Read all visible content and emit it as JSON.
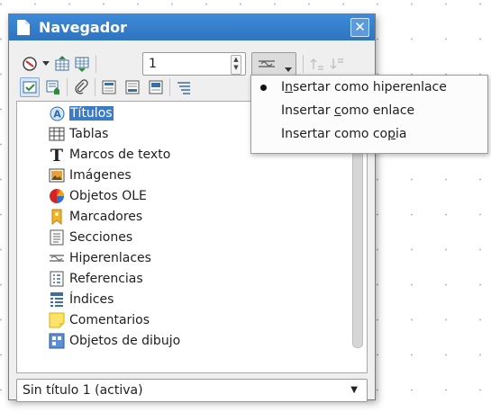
{
  "window": {
    "title": "Navegador",
    "close_glyph": "✕"
  },
  "toolbar": {
    "page_value": "1",
    "drag_mode_icon": "hyperlink-drag-icon",
    "colors": {
      "accent": "#2f74bf",
      "selection": "#3a7cc8"
    }
  },
  "tree": {
    "items": [
      {
        "label": "Títulos",
        "icon": "headings-icon"
      },
      {
        "label": "Tablas",
        "icon": "table-icon"
      },
      {
        "label": "Marcos de texto",
        "icon": "text-frame-icon"
      },
      {
        "label": "Imágenes",
        "icon": "image-icon"
      },
      {
        "label": "Objetos OLE",
        "icon": "ole-object-icon"
      },
      {
        "label": "Marcadores",
        "icon": "bookmark-icon"
      },
      {
        "label": "Secciones",
        "icon": "section-icon"
      },
      {
        "label": "Hiperenlaces",
        "icon": "hyperlink-icon"
      },
      {
        "label": "Referencias",
        "icon": "reference-icon"
      },
      {
        "label": "Índices",
        "icon": "index-icon"
      },
      {
        "label": "Comentarios",
        "icon": "comment-icon"
      },
      {
        "label": "Objetos de dibujo",
        "icon": "drawing-object-icon"
      }
    ]
  },
  "document_select": {
    "value": "Sin título 1 (activa)"
  },
  "drag_menu": {
    "item1_pre": "I",
    "item1_u": "n",
    "item1_post": "sertar como hiperenlace",
    "item2_pre": "Insertar ",
    "item2_u": "c",
    "item2_post": "omo enlace",
    "item3_pre": "Insertar como co",
    "item3_u": "p",
    "item3_post": "ia"
  }
}
